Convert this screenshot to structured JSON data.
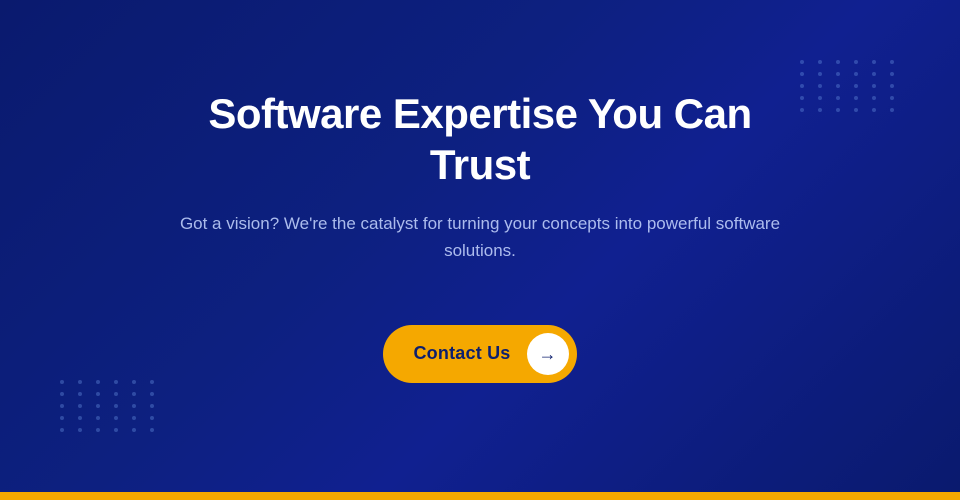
{
  "hero": {
    "title": "Software Expertise You Can Trust",
    "subtitle": "Got a vision? We're the catalyst for turning your concepts into powerful software solutions.",
    "cta_label": "Contact Us",
    "arrow": "→"
  },
  "colors": {
    "background_start": "#0a1a6e",
    "background_end": "#102090",
    "accent": "#f5a800",
    "text_primary": "#ffffff",
    "text_secondary": "rgba(200,215,255,0.85)",
    "bottom_bar": "#f5a800"
  },
  "dots": {
    "count": 30
  }
}
